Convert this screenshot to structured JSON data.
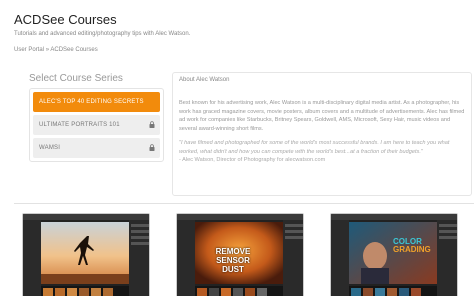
{
  "page": {
    "title": "ACDSee Courses",
    "subtitle": "Tutorials and advanced editing/photography tips with Alec Watson.",
    "breadcrumb": {
      "home": "User Portal",
      "separator": "»",
      "current": "ACDSee Courses"
    }
  },
  "series": {
    "heading": "Select Course Series",
    "items": [
      {
        "label": "ALEC'S TOP 40 EDITING SECRETS",
        "active": true,
        "locked": false
      },
      {
        "label": "ULTIMATE PORTRAITS 101",
        "active": false,
        "locked": true
      },
      {
        "label": "WAMSI",
        "active": false,
        "locked": true
      }
    ]
  },
  "about": {
    "title": "About Alec Watson",
    "body": "Best known for his advertising work, Alec Watson is a multi-disciplinary digital media artist. As a photographer, his work has graced magazine covers, movie posters, album covers and a multitude of advertisements. Alec has filmed ad work for companies like Starbucks, Britney Spears, Goldwell, AMS, Microsoft, Sexy Hair, music videos and several award-winning short films.",
    "quote": "\"I have filmed and photographed for some of the world's most successful brands. I am here to teach you what worked, what didn't and how you can compete with the world's best...at a fraction of their budgets.\"",
    "credit": "- Alec Watson, Director of Photography for alecwatson.com"
  },
  "thumbnails": [
    {
      "name": "Silhouette dancer at sunset",
      "overlay_lines": []
    },
    {
      "name": "Sensor dust course",
      "overlay_lines": [
        "REMOVE",
        "SENSOR",
        "DUST"
      ]
    },
    {
      "name": "Color grading course",
      "overlay_lines": [
        "COLOR",
        "GRADING"
      ]
    }
  ],
  "colors": {
    "accent": "#f28b0c",
    "inactive_item": "#eeeeee",
    "text_muted": "#999999"
  },
  "icons": {
    "lock": "lock-icon"
  }
}
